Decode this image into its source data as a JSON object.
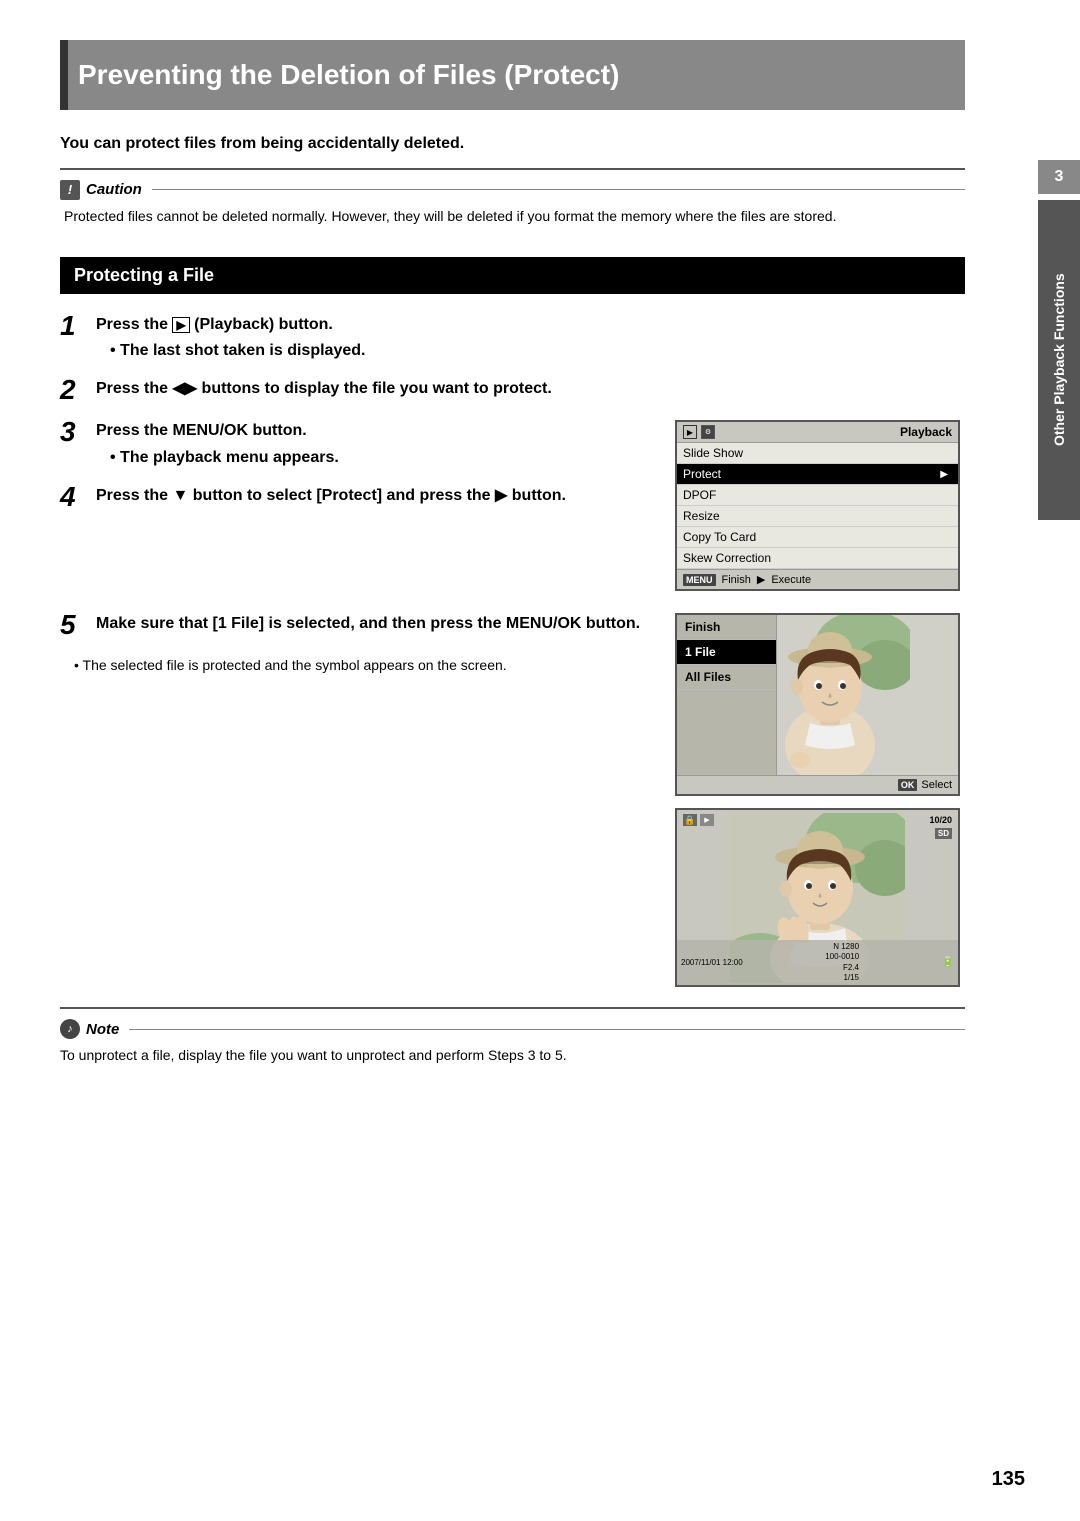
{
  "title": "Preventing the Deletion of Files (Protect)",
  "intro": "You can protect files from being accidentally deleted.",
  "caution": {
    "label": "Caution",
    "text": "Protected files cannot be deleted normally. However, they will be deleted if you format the memory where the files are stored."
  },
  "section_title": "Protecting a File",
  "steps": [
    {
      "number": "1",
      "text": "Press the  (Playback) button.",
      "sub": "The last shot taken is displayed."
    },
    {
      "number": "2",
      "text": "Press the  buttons to display the file you want to protect."
    },
    {
      "number": "3",
      "text": "Press the MENU/OK button.",
      "sub": "The playback menu appears."
    },
    {
      "number": "4",
      "text": "Press the  button to select [Protect] and press the  button."
    },
    {
      "number": "5",
      "text": "Make sure that [1 File] is selected, and then press the MENU/OK button."
    }
  ],
  "screen1": {
    "mode": "Playback",
    "items": [
      {
        "label": "Slide Show",
        "arrow": false
      },
      {
        "label": "Protect",
        "arrow": true,
        "highlight": true
      },
      {
        "label": "DPOF",
        "arrow": false
      },
      {
        "label": "Resize",
        "arrow": false
      },
      {
        "label": "Copy To Card",
        "arrow": false
      },
      {
        "label": "Skew Correction",
        "arrow": false
      }
    ],
    "footer_menu": "Finish",
    "footer_action": "Execute"
  },
  "screen2": {
    "options": [
      {
        "label": "Finish",
        "active": false
      },
      {
        "label": "1 File",
        "active": true
      },
      {
        "label": "All Files",
        "active": false
      }
    ],
    "footer_btn": "OK",
    "footer_label": "Select"
  },
  "screen3": {
    "play_icon": "▶",
    "sd_label": "SD",
    "photo_count": "10/20",
    "n_label": "N 1280",
    "file_num": "100-0010",
    "aperture": "F2.4",
    "shutter": "1/15",
    "date": "2007/11/01 12:00"
  },
  "bullet_note": "The selected file is protected and the symbol appears on the screen.",
  "note": {
    "label": "Note",
    "text": "To unprotect a file, display the file you want to unprotect and perform Steps 3 to 5."
  },
  "page_number": "135",
  "chapter_number": "3",
  "sidebar_label": "Other Playback Functions"
}
